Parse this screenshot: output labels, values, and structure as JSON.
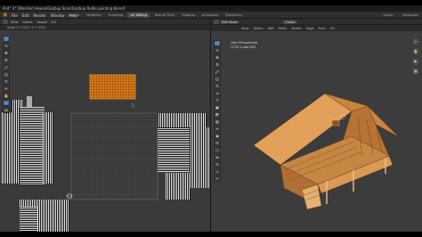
{
  "app": {
    "title": "4x4° 3° [Blender] House/Gazbup Scan/Gazbup Ruble painting.blend]",
    "logo_icon": "blender-logo-icon"
  },
  "menubar": {
    "items": [
      "File",
      "Edit",
      "Render",
      "Window",
      "Help"
    ],
    "workspaces": [
      "Layout",
      "Modeling",
      "Sculpting",
      "UV Editing",
      "Texture Paint",
      "Shading",
      "Animation",
      "Rendering"
    ],
    "active_workspace": "UV Editing",
    "right": [
      "Scene",
      "ViewLayer"
    ]
  },
  "uv_editor": {
    "header_items": [
      "View",
      "Select",
      "Image",
      "UV"
    ],
    "scale_label": "Scale X: 0.5221   Y: 0.5221",
    "tools": [
      "select-box-icon",
      "cursor-icon",
      "move-icon",
      "rotate-icon",
      "scale-icon",
      "transform-icon",
      "annotate-icon",
      "rip-icon",
      "grab-icon",
      "relax-icon",
      "pinch-icon"
    ]
  },
  "viewport": {
    "mode": "Edit Mode",
    "menus": [
      "View",
      "Select",
      "Add",
      "Mesh",
      "Vertex",
      "Edge",
      "Face",
      "UV"
    ],
    "orientation": "Global",
    "info_line1": "User Perspective",
    "info_line2": "(113) Cube.005",
    "tools": [
      "select-box-icon",
      "cursor-icon",
      "move-icon",
      "rotate-icon",
      "scale-icon",
      "transform-icon",
      "annotate-icon",
      "measure-icon",
      "extrude-icon",
      "inset-icon",
      "bevel-icon",
      "loop-cut-icon",
      "knife-icon",
      "poly-build-icon",
      "spin-icon",
      "smooth-icon",
      "edge-slide-icon",
      "shrink-icon",
      "shear-icon",
      "rip-icon"
    ],
    "nav": [
      "zoom-icon",
      "hand-icon",
      "camera-icon",
      "grid-icon"
    ]
  },
  "colors": {
    "accent": "#4772b3",
    "mesh": "#d8944a",
    "blender_orange": "#e87d0d"
  }
}
